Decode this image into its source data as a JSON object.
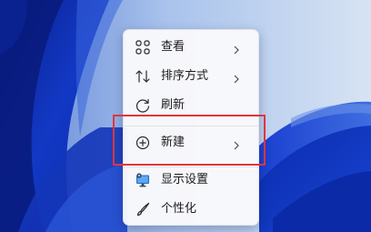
{
  "context_menu": {
    "items": [
      {
        "label": "查看",
        "icon": "view-grid-icon",
        "has_submenu": true
      },
      {
        "label": "排序方式",
        "icon": "sort-arrows-icon",
        "has_submenu": true
      },
      {
        "label": "刷新",
        "icon": "refresh-icon",
        "has_submenu": false
      },
      {
        "label": "新建",
        "icon": "new-plus-icon",
        "has_submenu": true
      },
      {
        "label": "显示设置",
        "icon": "display-settings-icon",
        "has_submenu": false
      },
      {
        "label": "个性化",
        "icon": "personalize-brush-icon",
        "has_submenu": false
      }
    ]
  },
  "highlight": {
    "target": "新建",
    "color": "#e0363c"
  },
  "colors": {
    "wallpaper_dark": "#0a2aa8",
    "wallpaper_light": "#c8d8ee",
    "accent_blue": "#1f6fd1",
    "menu_bg": "#f9f9fb",
    "text": "#1b1b1b"
  }
}
